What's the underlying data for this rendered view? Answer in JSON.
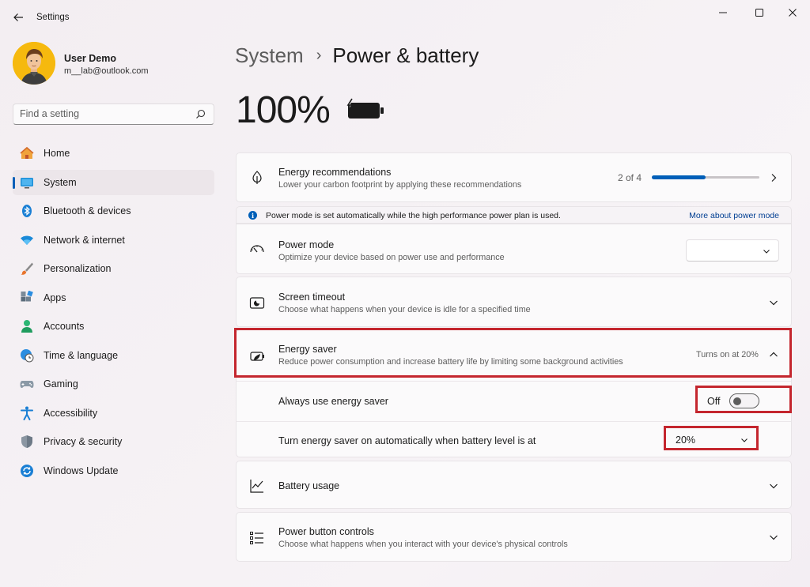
{
  "window": {
    "title": "Settings",
    "controls": [
      "minimize-icon",
      "maximize-icon",
      "close-icon"
    ]
  },
  "user": {
    "name": "User Demo",
    "email": "m__lab@outlook.com"
  },
  "search": {
    "placeholder": "Find a setting"
  },
  "sidebar": {
    "items": [
      {
        "label": "Home",
        "icon": "home-icon",
        "active": false
      },
      {
        "label": "System",
        "icon": "system-icon",
        "active": true
      },
      {
        "label": "Bluetooth & devices",
        "icon": "bluetooth-icon",
        "active": false
      },
      {
        "label": "Network & internet",
        "icon": "wifi-icon",
        "active": false
      },
      {
        "label": "Personalization",
        "icon": "brush-icon",
        "active": false
      },
      {
        "label": "Apps",
        "icon": "apps-icon",
        "active": false
      },
      {
        "label": "Accounts",
        "icon": "accounts-icon",
        "active": false
      },
      {
        "label": "Time & language",
        "icon": "globe-clock-icon",
        "active": false
      },
      {
        "label": "Gaming",
        "icon": "gamepad-icon",
        "active": false
      },
      {
        "label": "Accessibility",
        "icon": "accessibility-icon",
        "active": false
      },
      {
        "label": "Privacy & security",
        "icon": "shield-icon",
        "active": false
      },
      {
        "label": "Windows Update",
        "icon": "update-icon",
        "active": false
      }
    ]
  },
  "breadcrumb": {
    "parent": "System",
    "separator": "›",
    "current": "Power & battery"
  },
  "battery": {
    "percent": "100%"
  },
  "energy_recommendations": {
    "title": "Energy recommendations",
    "description": "Lower your carbon footprint by applying these recommendations",
    "progress_text": "2 of 4",
    "progress_fraction": 0.5
  },
  "info_bar": {
    "text": "Power mode is set automatically while the high performance power plan is used.",
    "link": "More about power mode"
  },
  "power_mode": {
    "title": "Power mode",
    "description": "Optimize your device based on power use and performance",
    "value": ""
  },
  "screen_timeout": {
    "title": "Screen timeout",
    "description": "Choose what happens when your device is idle for a specified time"
  },
  "energy_saver": {
    "title": "Energy saver",
    "description": "Reduce power consumption and increase battery life by limiting some background activities",
    "status": "Turns on at 20%",
    "always_label": "Always use energy saver",
    "always_state": "Off",
    "auto_label": "Turn energy saver on automatically when battery level is at",
    "auto_value": "20%"
  },
  "battery_usage": {
    "title": "Battery usage"
  },
  "power_button": {
    "title": "Power button controls",
    "description": "Choose what happens when you interact with your device's physical controls"
  },
  "colors": {
    "accent": "#005fb8",
    "highlight": "#c4262e",
    "link": "#003e92"
  }
}
